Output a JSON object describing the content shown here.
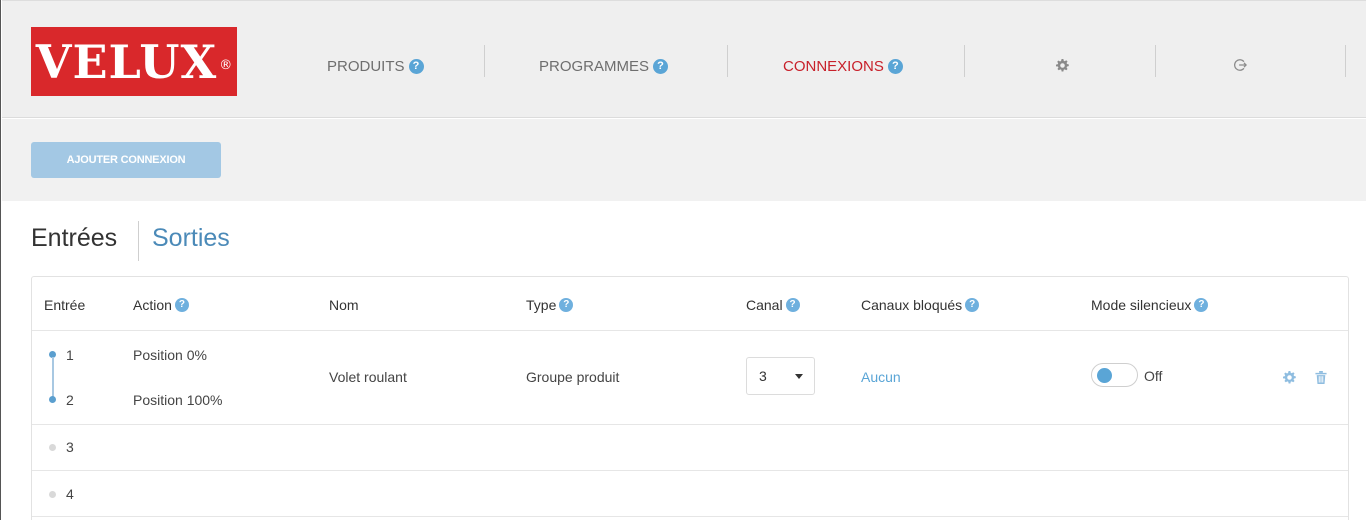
{
  "brand": {
    "logo_text": "VELUX",
    "logo_mark": "®",
    "color": "#d9282b"
  },
  "nav": {
    "items": [
      {
        "label": "PRODUITS",
        "help": "?"
      },
      {
        "label": "PROGRAMMES",
        "help": "?"
      },
      {
        "label": "CONNEXIONS",
        "help": "?",
        "active": true
      }
    ],
    "icons": [
      "gear-icon",
      "logout-icon"
    ],
    "active_color": "#c8202a"
  },
  "toolbar": {
    "add_label": "AJOUTER CONNEXION"
  },
  "tabs": {
    "entrees": "Entrées",
    "sorties": "Sorties"
  },
  "table": {
    "headers": {
      "entree": "Entrée",
      "action": "Action",
      "nom": "Nom",
      "type": "Type",
      "canal": "Canal",
      "canaux": "Canaux bloqués",
      "mode": "Mode silencieux"
    },
    "row1": {
      "entree_a": "1",
      "entree_b": "2",
      "action_a": "Position 0%",
      "action_b": "Position 100%",
      "nom": "Volet roulant",
      "type": "Groupe produit",
      "canal": "3",
      "canaux_bloques": "Aucun",
      "mode_label": "Off"
    },
    "row3": {
      "entree": "3"
    },
    "row4": {
      "entree": "4"
    }
  },
  "help_glyph": "?",
  "accent_color": "#5aa5d6"
}
